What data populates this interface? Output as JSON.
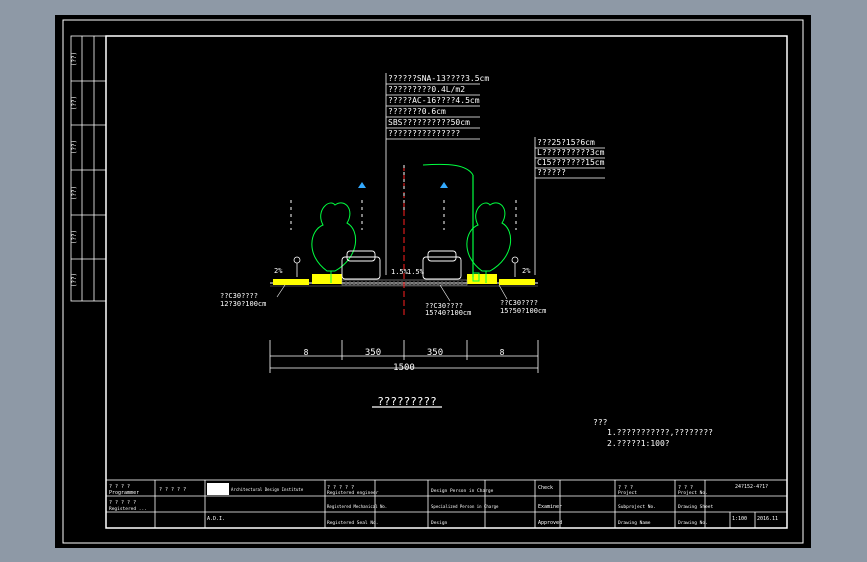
{
  "pavement_callout": [
    "??????SNA-13????3.5cm",
    "?????????0.4L/m2",
    "?????AC-16????4.5cm",
    "???????0.6cm",
    "SBS??????????50cm",
    "???????????????"
  ],
  "sidewalk_callout": [
    "???25?15?6cm",
    "L??????????3cm",
    "C15???????15cm",
    "??????"
  ],
  "labels": {
    "slope_left": "2%",
    "slope_right": "2%",
    "crown": "1.5%",
    "crown_right": "1.5%",
    "curb_left_1": "??C30????",
    "curb_left_2": "12?30?100cm",
    "curb_mid_1": "??C30????",
    "curb_mid_2": "15?40?100cm",
    "curb_right_1": "??C30????",
    "curb_right_2": "15?50?100cm"
  },
  "dimensions": {
    "left": "8",
    "mid_left": "350",
    "mid_right": "350",
    "right": "8",
    "total": "1500"
  },
  "drawing_title": "?????????",
  "notes": {
    "heading": "???",
    "line1": "1.???????????,????????",
    "line2": "2.?????1:100?"
  },
  "title_block": {
    "r1c1": "? ? ? ?",
    "r1c1b": "Programmer",
    "r1c2": "? ? ? ? ?",
    "r1c4": "Registered  engineer",
    "r1c5": "Design  Person  in  Charge",
    "r1c6": "Check",
    "r1c7": "Project",
    "r1c8": "Project  No.",
    "r1c9": "24?152-4?1?",
    "r2c1": "? ? ? ? ?",
    "r2c1b": "Registered  ... ",
    "r2c4": "Registered  Mechanical  No.",
    "r2c5": "Specialized  Person  in  Charge",
    "r2c6": "Examiner",
    "r2c7": "Subproject  No.",
    "r2c8": "Drawing  Sheet",
    "r3c4": "Registered  Seal  No.",
    "r3c5": "Design",
    "r3c6": "Approved",
    "r3c7": "Drawing  Name",
    "r3c8": "Drawing  No.",
    "r3c9": "1:100",
    "r3c10": "2016.11",
    "company": "Architectural  Design  Institute",
    "company2": "A.D.I."
  },
  "side_strip": [
    "(??)",
    "(??)",
    "(??)",
    "(??)",
    "(??)",
    "(??)"
  ]
}
